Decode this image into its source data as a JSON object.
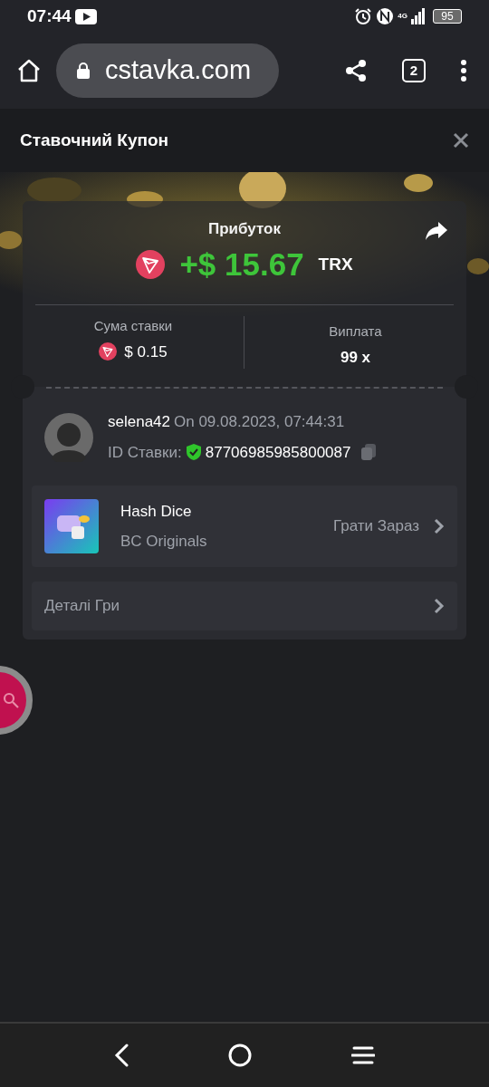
{
  "status_bar": {
    "time": "07:44",
    "network": "4G",
    "battery": "95"
  },
  "browser": {
    "url": "cstavka.com",
    "tab_count": "2"
  },
  "modal": {
    "title": "Ставочний Купон"
  },
  "profit": {
    "label": "Прибуток",
    "amount": "+$ 15.67",
    "currency": "TRX"
  },
  "stats": [
    {
      "label": "Сума ставки",
      "value": "$ 0.15",
      "kind": "coin"
    },
    {
      "label": "Виплата",
      "value": "99 x",
      "kind": "plain"
    }
  ],
  "bet": {
    "user": "selena42",
    "date": "On 09.08.2023, 07:44:31",
    "id_label": "ID Ставки:",
    "id": "87706985985800087",
    "verified": true
  },
  "game": {
    "name": "Hash Dice",
    "provider": "BC Originals",
    "action": "Грати Зараз"
  },
  "details": {
    "label": "Деталі Гри"
  }
}
